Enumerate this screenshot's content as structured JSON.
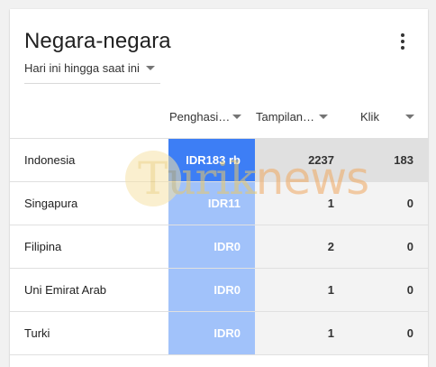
{
  "card": {
    "title": "Negara-negara",
    "menu_icon": "more-vert-icon",
    "date_range": "Hari ini hingga saat ini"
  },
  "columns": [
    {
      "label": "Penghasi…"
    },
    {
      "label": "Tampilan…"
    },
    {
      "label": "Klik"
    }
  ],
  "rows": [
    {
      "country": "Indonesia",
      "revenue": "IDR183 rb",
      "impressions": "2237",
      "clicks": "183"
    },
    {
      "country": "Singapura",
      "revenue": "IDR11",
      "impressions": "1",
      "clicks": "0"
    },
    {
      "country": "Filipina",
      "revenue": "IDR0",
      "impressions": "2",
      "clicks": "0"
    },
    {
      "country": "Uni Emirat Arab",
      "revenue": "IDR0",
      "impressions": "1",
      "clicks": "0"
    },
    {
      "country": "Turki",
      "revenue": "IDR0",
      "impressions": "1",
      "clicks": "0"
    }
  ],
  "watermark": {
    "part1": "Turik",
    "part2": "news"
  },
  "colors": {
    "revenue_highlight": "#3d7ef5",
    "revenue_column": "#a1c2fa",
    "row_highlight": "#e0e0e0",
    "page_bg": "#f1f1f1"
  }
}
